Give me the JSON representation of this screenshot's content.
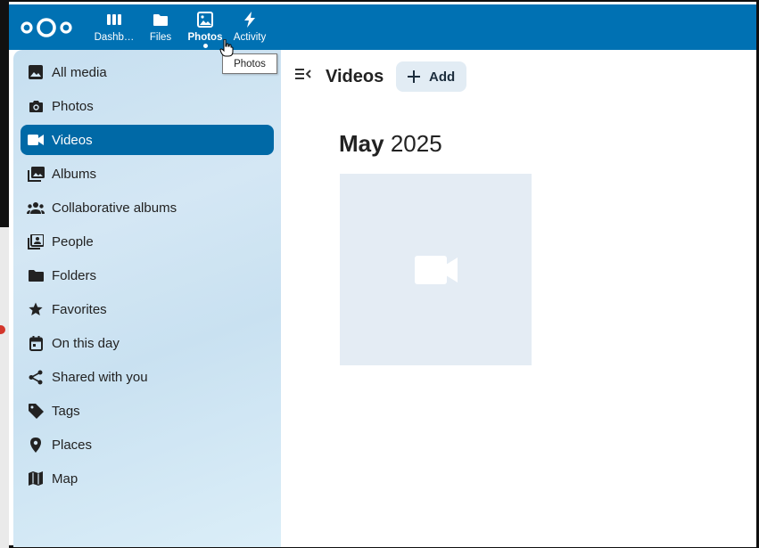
{
  "header": {
    "apps": [
      {
        "label": "Dashb…",
        "icon": "dashboard-icon"
      },
      {
        "label": "Files",
        "icon": "folder-icon"
      },
      {
        "label": "Photos",
        "icon": "image-icon",
        "active": true
      },
      {
        "label": "Activity",
        "icon": "lightning-icon"
      }
    ],
    "tooltip": "Photos",
    "color": "#0071b3"
  },
  "sidebar": {
    "items": [
      {
        "label": "All media",
        "icon": "image-icon"
      },
      {
        "label": "Photos",
        "icon": "camera-icon"
      },
      {
        "label": "Videos",
        "icon": "video-icon",
        "active": true
      },
      {
        "label": "Albums",
        "icon": "album-icon"
      },
      {
        "label": "Collaborative albums",
        "icon": "people-group-icon"
      },
      {
        "label": "People",
        "icon": "person-box-icon"
      },
      {
        "label": "Folders",
        "icon": "folder-icon"
      },
      {
        "label": "Favorites",
        "icon": "star-icon"
      },
      {
        "label": "On this day",
        "icon": "calendar-icon"
      },
      {
        "label": "Shared with you",
        "icon": "share-icon"
      },
      {
        "label": "Tags",
        "icon": "tag-icon"
      },
      {
        "label": "Places",
        "icon": "map-marker-icon"
      },
      {
        "label": "Map",
        "icon": "map-icon"
      }
    ],
    "active_color": "#0069a6"
  },
  "main": {
    "title": "Videos",
    "add_label": "Add",
    "month": "May",
    "year": "2025"
  }
}
